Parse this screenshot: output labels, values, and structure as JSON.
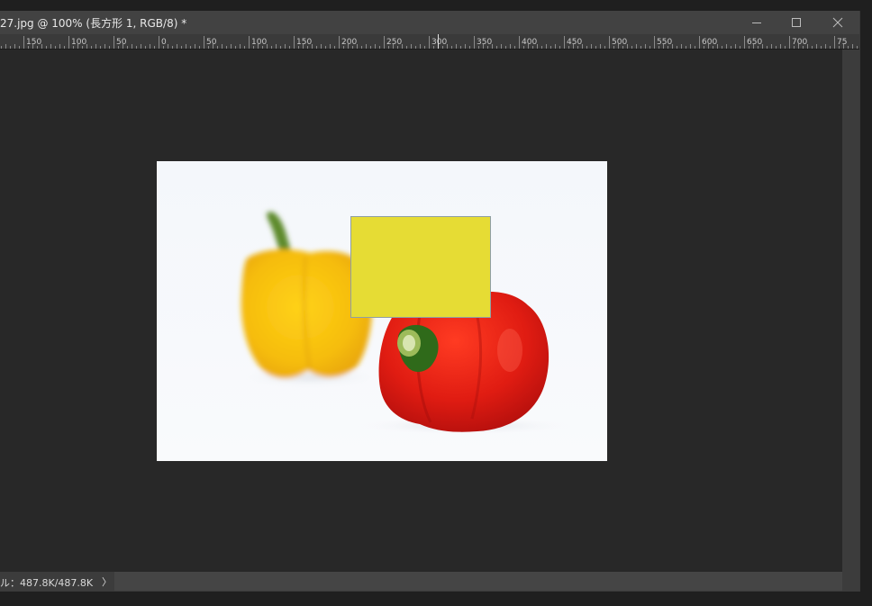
{
  "window": {
    "title": "27.jpg @ 100% (長方形 1, RGB/8) *",
    "controls": {
      "minimize_icon": "minimize-icon",
      "maximize_icon": "maximize-icon",
      "close_icon": "close-icon"
    }
  },
  "ruler": {
    "labels": [
      "150",
      "100",
      "50",
      "0",
      "50",
      "100",
      "150",
      "200",
      "250",
      "300",
      "350",
      "400",
      "450",
      "500",
      "550",
      "600",
      "650",
      "700",
      "75"
    ]
  },
  "document": {
    "content": "bell-peppers-photo",
    "shape_layer_color": "#e6dc34"
  },
  "status": {
    "text": "ル：487.8K/487.8K",
    "arrow": "〉"
  },
  "colors": {
    "pasteboard": "#282828",
    "titlebar": "#424242",
    "ruler": "#3a3a3a",
    "statusbar": "#3c3c3c"
  }
}
